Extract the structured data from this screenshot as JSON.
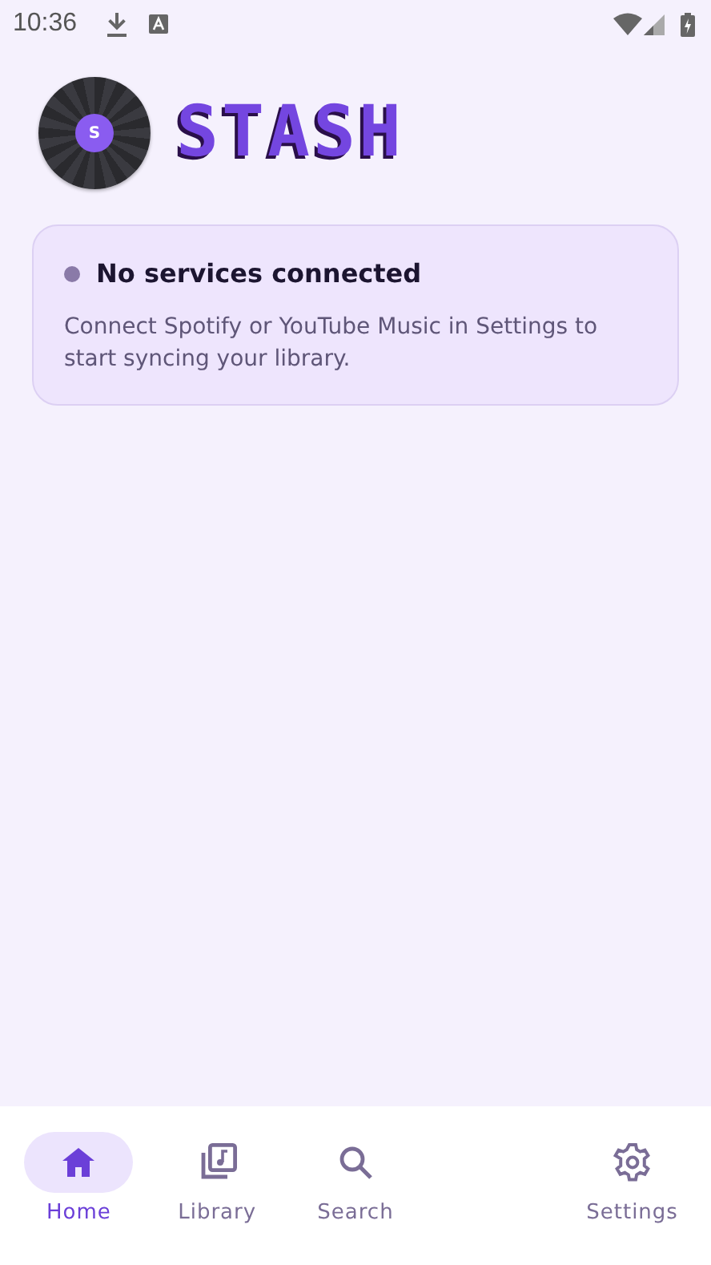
{
  "status_bar": {
    "time": "10:36"
  },
  "app": {
    "title": "STASH",
    "logo_letter": "S"
  },
  "status_card": {
    "title": "No services connected",
    "message": "Connect Spotify or YouTube Music in Settings to start syncing your library."
  },
  "nav": [
    {
      "label": "Home",
      "kind": "home",
      "selected": true
    },
    {
      "label": "Library",
      "kind": "library",
      "selected": false
    },
    {
      "label": "Search",
      "kind": "search",
      "selected": false
    },
    {
      "label": "Settings",
      "kind": "settings",
      "selected": false
    }
  ]
}
